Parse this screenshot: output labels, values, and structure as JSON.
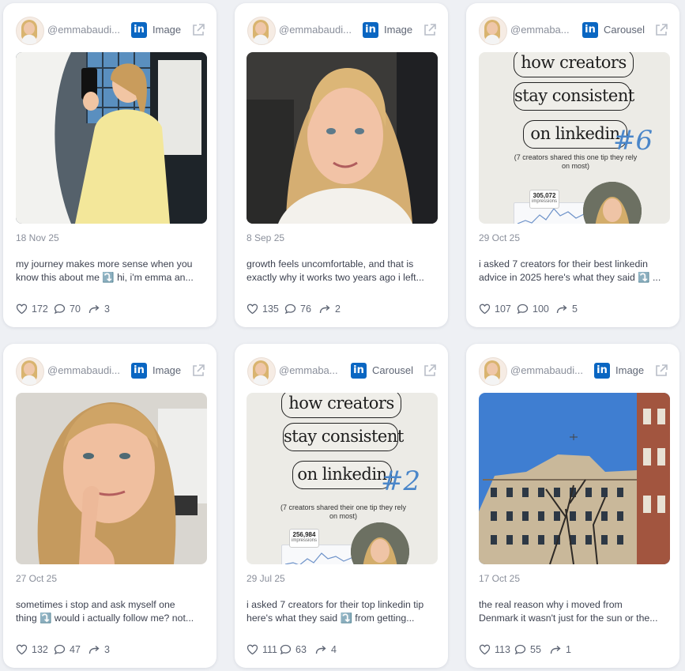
{
  "colors": {
    "accent_linkedin": "#0a66c2",
    "card_bg": "#ffffff",
    "page_bg": "#eef0f4",
    "hashtag_blue": "#4a86c9"
  },
  "cards": [
    {
      "handle": "@emmabaudi...",
      "type": "Image",
      "date": "18 Nov 25",
      "caption_line1": "my journey makes more sense when you",
      "caption_line2": "know this about me ⤵️ hi, i'm emma an...",
      "likes": "172",
      "comments": "70",
      "reposts": "3",
      "media": "mirror-selfie-photo"
    },
    {
      "handle": "@emmabaudi...",
      "type": "Image",
      "date": "8 Sep 25",
      "caption_line1": "growth feels uncomfortable, and that is",
      "caption_line2": "exactly why it works two years ago i left...",
      "likes": "135",
      "comments": "76",
      "reposts": "2",
      "media": "portrait-photo"
    },
    {
      "handle": "@emmaba...",
      "type": "Carousel",
      "date": "29 Oct 25",
      "caption_line1": "i asked 7 creators for their best linkedin",
      "caption_line2": "advice in 2025 here's what they said ⤵️ ...",
      "likes": "107",
      "comments": "100",
      "reposts": "5",
      "slide": {
        "line1": "how creators",
        "line2": "stay consistent",
        "line3": "on linkedin",
        "number": "#6",
        "note": "(7 creators shared this one tip they rely on most)",
        "stat_value": "305,072",
        "stat_label": "impressions"
      }
    },
    {
      "handle": "@emmabaudi...",
      "type": "Image",
      "date": "27 Oct 25",
      "caption_line1": "sometimes i stop and ask myself one",
      "caption_line2": "thing ⤵️ would i actually follow me? not...",
      "likes": "132",
      "comments": "47",
      "reposts": "3",
      "media": "thinking-selfie-photo"
    },
    {
      "handle": "@emmaba...",
      "type": "Carousel",
      "date": "29 Jul 25",
      "caption_line1": "i asked 7 creators for their top linkedin tip",
      "caption_line2": "here's what they said ⤵️ from getting...",
      "likes": "111",
      "comments": "63",
      "reposts": "4",
      "slide": {
        "line1": "how creators",
        "line2": "stay consistent",
        "line3": "on linkedin",
        "number": "#2",
        "note": "(7 creators shared their one tip they rely on most)",
        "stat_value": "256,984",
        "stat_label": "impressions"
      }
    },
    {
      "handle": "@emmabaudi...",
      "type": "Image",
      "date": "17 Oct 25",
      "caption_line1": "the real reason why i moved from",
      "caption_line2": "Denmark it wasn't just for the sun or the...",
      "likes": "113",
      "comments": "55",
      "reposts": "1",
      "media": "building-photo"
    }
  ]
}
